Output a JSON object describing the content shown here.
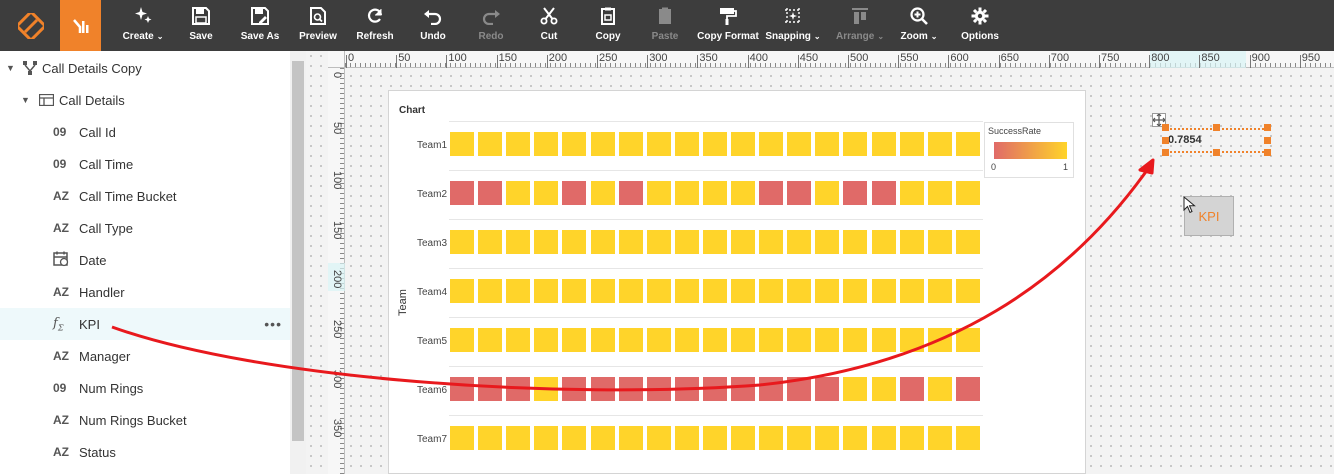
{
  "toolbar": {
    "buttons": [
      {
        "id": "create",
        "label": "Create",
        "caret": "⌄",
        "icon": "sparkle-icon",
        "disabled": false
      },
      {
        "id": "save",
        "label": "Save",
        "icon": "floppy-icon",
        "disabled": false
      },
      {
        "id": "save-as",
        "label": "Save As",
        "icon": "floppy-edit-icon",
        "disabled": false
      },
      {
        "id": "preview",
        "label": "Preview",
        "icon": "preview-icon",
        "disabled": false
      },
      {
        "id": "refresh",
        "label": "Refresh",
        "icon": "refresh-icon",
        "disabled": false
      },
      {
        "id": "undo",
        "label": "Undo",
        "icon": "undo-icon",
        "disabled": false
      },
      {
        "id": "redo",
        "label": "Redo",
        "icon": "redo-icon",
        "disabled": true
      },
      {
        "id": "cut",
        "label": "Cut",
        "icon": "scissors-icon",
        "disabled": false
      },
      {
        "id": "copy",
        "label": "Copy",
        "icon": "copy-icon",
        "disabled": false
      },
      {
        "id": "paste",
        "label": "Paste",
        "icon": "clipboard-icon",
        "disabled": true
      },
      {
        "id": "copy-format",
        "label": "Copy Format",
        "icon": "paint-roller-icon",
        "disabled": false
      },
      {
        "id": "snapping",
        "label": "Snapping",
        "caret": "⌄",
        "icon": "snapping-icon",
        "disabled": false
      },
      {
        "id": "arrange",
        "label": "Arrange",
        "caret": "⌄",
        "icon": "arrange-icon",
        "disabled": true
      },
      {
        "id": "zoom",
        "label": "Zoom",
        "caret": "⌄",
        "icon": "zoom-in-icon",
        "disabled": false
      },
      {
        "id": "options",
        "label": "Options",
        "icon": "gear-icon",
        "disabled": false
      }
    ]
  },
  "sidebar": {
    "root_label": "Call Details Copy",
    "table_label": "Call Details",
    "fields": [
      {
        "type_icon": "09",
        "label": "Call Id"
      },
      {
        "type_icon": "09",
        "label": "Call Time"
      },
      {
        "type_icon": "AZ",
        "label": "Call Time Bucket"
      },
      {
        "type_icon": "AZ",
        "label": "Call Type"
      },
      {
        "type_icon": "date",
        "label": "Date"
      },
      {
        "type_icon": "AZ",
        "label": "Handler"
      },
      {
        "type_icon": "fx",
        "label": "KPI",
        "active": true
      },
      {
        "type_icon": "AZ",
        "label": "Manager"
      },
      {
        "type_icon": "09",
        "label": "Num Rings"
      },
      {
        "type_icon": "AZ",
        "label": "Num Rings Bucket"
      },
      {
        "type_icon": "AZ",
        "label": "Status"
      }
    ],
    "more_label": "•••"
  },
  "rulers": {
    "top_labels": [
      "0",
      "50",
      "100",
      "150",
      "200",
      "250",
      "300",
      "350",
      "400",
      "450",
      "500",
      "550",
      "600",
      "650",
      "700",
      "750",
      "800",
      "850",
      "900",
      "950"
    ],
    "left_labels": [
      "0",
      "50",
      "100",
      "150",
      "200",
      "250",
      "300",
      "350"
    ]
  },
  "chart_data": {
    "type": "heatmap",
    "title": "Chart",
    "ylabel": "Team",
    "categories": [
      "Team1",
      "Team2",
      "Team3",
      "Team4",
      "Team5",
      "Team6",
      "Team7"
    ],
    "rows": [
      "YYYYYYYYYYYYYYYYYYY",
      "RRYYRYRYYYYRRYRRYYY",
      "YYYYYYYYYYYYYYYYYYY",
      "YYYYYYYYYYYYYYYYYYY",
      "YYYYYYYYYYYYYYYYYYY",
      "RRRYRRRRRRRRRRYYRYR",
      "YYYYYYYYYYYYYYYYYYY"
    ],
    "legend": {
      "title": "SuccessRate",
      "min": "0",
      "max": "1",
      "colors": [
        "#e06a68",
        "#ffd42a"
      ]
    },
    "colors": {
      "Y": "#ffd42a",
      "R": "#e06a68"
    }
  },
  "kpi": {
    "value": "0.7854",
    "ghost_label": "KPI"
  },
  "colors": {
    "accent": "#f0822a",
    "arrow": "#e8191d"
  }
}
